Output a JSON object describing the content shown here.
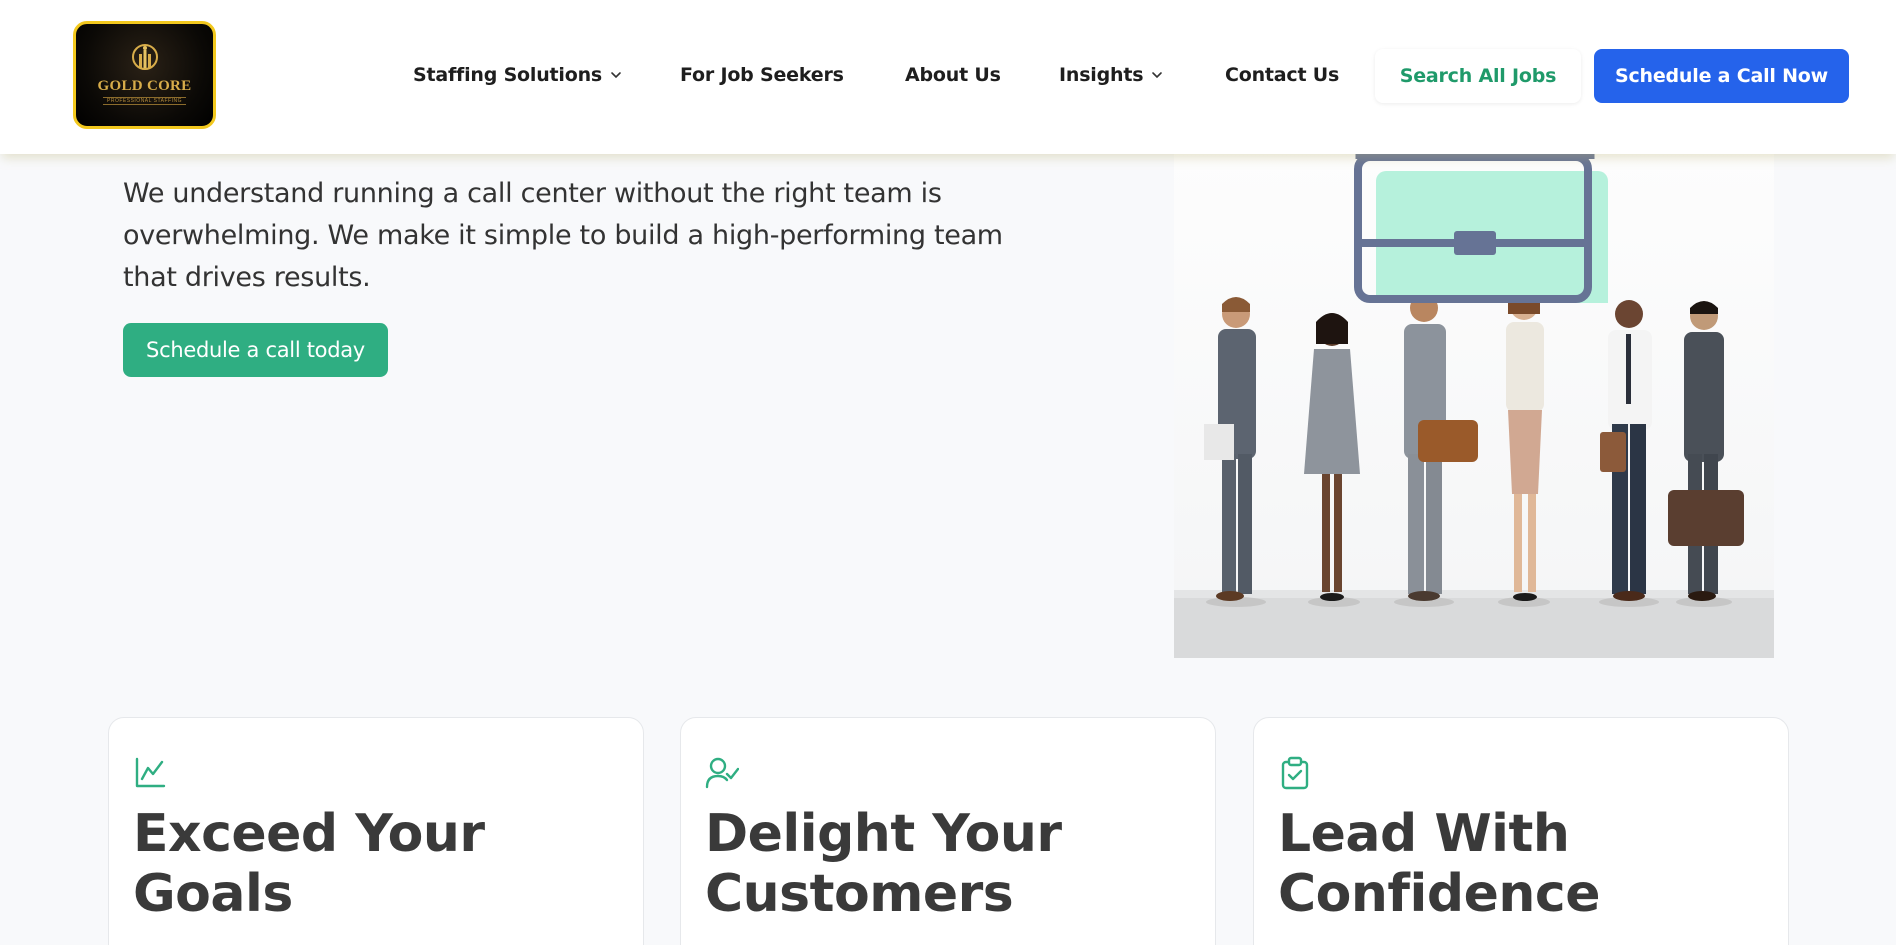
{
  "brand": {
    "name": "GOLD CORE",
    "tagline": "PROFESSIONAL STAFFING",
    "colors": {
      "gold": "#f2c81e",
      "green": "#2fae82",
      "blue": "#2563eb"
    }
  },
  "nav": {
    "items": [
      {
        "label": "Staffing Solutions",
        "has_dropdown": true
      },
      {
        "label": "For Job Seekers",
        "has_dropdown": false
      },
      {
        "label": "About Us",
        "has_dropdown": false
      },
      {
        "label": "Insights",
        "has_dropdown": true
      },
      {
        "label": "Contact Us",
        "has_dropdown": false
      }
    ],
    "search_jobs_label": "Search All Jobs",
    "schedule_call_label": "Schedule a Call Now"
  },
  "hero": {
    "description": "We understand running a call center without the right team is overwhelming. We make it simple to build a high-performing team that drives results.",
    "cta_label": "Schedule a call today"
  },
  "cards": [
    {
      "icon": "chart-line-icon",
      "title": "Exceed Your Goals"
    },
    {
      "icon": "user-check-icon",
      "title": "Delight Your Customers"
    },
    {
      "icon": "clipboard-check-icon",
      "title": "Lead With Confidence"
    }
  ]
}
